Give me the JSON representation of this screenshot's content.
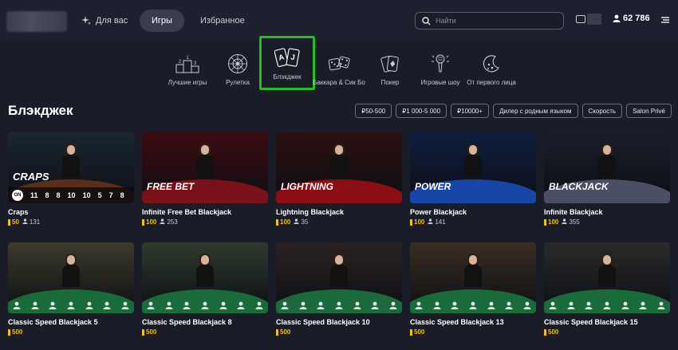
{
  "header": {
    "for_you": "Для вас",
    "games": "Игры",
    "favorites": "Избранное",
    "search_placeholder": "Найти",
    "balance": "62 786"
  },
  "categories": [
    {
      "label": "Лучшие игры",
      "icon": "podium-icon"
    },
    {
      "label": "Рулетка",
      "icon": "roulette-icon"
    },
    {
      "label": "Блэкджек",
      "icon": "cards-icon"
    },
    {
      "label": "Баккара & Сик Бо",
      "icon": "dice-icon"
    },
    {
      "label": "Покер",
      "icon": "poker-icon"
    },
    {
      "label": "Игровые шоу",
      "icon": "microphone-icon"
    },
    {
      "label": "От первого лица",
      "icon": "moon-icon"
    }
  ],
  "section_title": "Блэкджек",
  "filters": [
    "₽50-500",
    "₽1 000-5 000",
    "₽10000+",
    "Дилер с родным языком",
    "Скорость",
    "Salon Privé"
  ],
  "craps_numbers": [
    "ON",
    "11",
    "8",
    "8",
    "10",
    "10",
    "5",
    "7",
    "8"
  ],
  "games": [
    {
      "name": "Craps",
      "bet": "50",
      "players": "131",
      "logo": "CRAPS",
      "felt": "#5a2f1a",
      "bg": "#1b2732"
    },
    {
      "name": "Infinite Free Bet Blackjack",
      "bet": "100",
      "players": "253",
      "logo": "FREE BET",
      "felt": "#7a1018",
      "bg": "#3c0b10"
    },
    {
      "name": "Lightning Blackjack",
      "bet": "100",
      "players": "35",
      "logo": "LIGHTNING",
      "felt": "#8a0e14",
      "bg": "#2b1010"
    },
    {
      "name": "Power Blackjack",
      "bet": "100",
      "players": "141",
      "logo": "POWER",
      "felt": "#1746a8",
      "bg": "#0f1e3f"
    },
    {
      "name": "Infinite Blackjack",
      "bet": "100",
      "players": "355",
      "logo": "BLACKJACK",
      "felt": "#4b4f63",
      "bg": "#1b1e2a"
    },
    {
      "name": "Classic Speed Blackjack 5",
      "bet": "500",
      "players": "",
      "logo": "",
      "felt": "#1a6b3a",
      "bg": "#3c3a2a"
    },
    {
      "name": "Classic Speed Blackjack 8",
      "bet": "500",
      "players": "",
      "logo": "",
      "felt": "#1a6b3a",
      "bg": "#2e3a2e"
    },
    {
      "name": "Classic Speed Blackjack 10",
      "bet": "500",
      "players": "",
      "logo": "",
      "felt": "#1c6a3c",
      "bg": "#2a2222"
    },
    {
      "name": "Classic Speed Blackjack 13",
      "bet": "500",
      "players": "",
      "logo": "",
      "felt": "#1a6b3a",
      "bg": "#3a2e22"
    },
    {
      "name": "Classic Speed Blackjack 15",
      "bet": "500",
      "players": "",
      "logo": "",
      "felt": "#1a6b3a",
      "bg": "#2a2a2a"
    }
  ]
}
